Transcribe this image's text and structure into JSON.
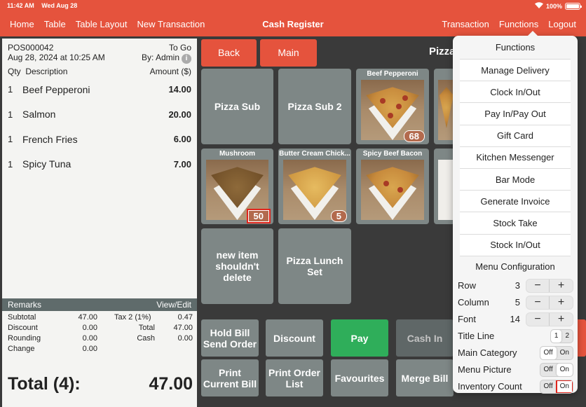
{
  "status_bar": {
    "time": "11:42 AM",
    "date": "Wed Aug 28",
    "wifi": "wifi-icon",
    "battery": "100%"
  },
  "nav": {
    "left": [
      "Home",
      "Table",
      "Table Layout",
      "New Transaction"
    ],
    "title": "Cash Register",
    "right": [
      "Transaction",
      "Functions",
      "Logout"
    ]
  },
  "receipt": {
    "number": "POS000042",
    "order_type": "To Go",
    "datetime": "Aug 28, 2024 at 10:25 AM",
    "by": "By: Admin",
    "columns": {
      "qty": "Qty",
      "description": "Description",
      "amount": "Amount ($)"
    },
    "items": [
      {
        "qty": "1",
        "description": "Beef Pepperoni",
        "amount": "14.00"
      },
      {
        "qty": "1",
        "description": "Salmon",
        "amount": "20.00"
      },
      {
        "qty": "1",
        "description": "French Fries",
        "amount": "6.00"
      },
      {
        "qty": "1",
        "description": "Spicy Tuna",
        "amount": "7.00"
      }
    ],
    "remarks_label": "Remarks",
    "view_edit": "View/Edit",
    "totals": {
      "subtotal_label": "Subtotal",
      "subtotal": "47.00",
      "tax_label": "Tax 2 (1%)",
      "tax": "0.47",
      "discount_label": "Discount",
      "discount": "0.00",
      "total_label": "Total",
      "total": "47.00",
      "rounding_label": "Rounding",
      "rounding": "0.00",
      "cash_label": "Cash",
      "cash": "0.00",
      "change_label": "Change",
      "change": "0.00"
    },
    "grand_total_label": "Total (4):",
    "grand_total": "47.00"
  },
  "main": {
    "back_label": "Back",
    "main_label": "Main",
    "category_title": "Pizza",
    "tiles": [
      {
        "name": "Pizza Sub"
      },
      {
        "name": "Pizza Sub 2"
      },
      {
        "name": "Beef Pepperoni",
        "count": "68"
      },
      {
        "name": "Mushroom",
        "count": "50"
      },
      {
        "name": "Butter Cream Chick...",
        "count": "5"
      },
      {
        "name": "Spicy Beef Bacon"
      },
      {
        "name": "new item shouldn't delete"
      },
      {
        "name": "Pizza Lunch Set"
      }
    ],
    "actions": {
      "hold_bill": "Hold Bill\nSend Order",
      "discount": "Discount",
      "pay": "Pay",
      "cash_in": "Cash In",
      "print_bill": "Print\nCurrent Bill",
      "print_order": "Print Order\nList",
      "favourites": "Favourites",
      "merge_bill": "Merge Bill"
    }
  },
  "functions_popover": {
    "title": "Functions",
    "items": [
      "Manage Delivery",
      "Clock In/Out",
      "Pay In/Pay Out",
      "Gift Card",
      "Kitchen Messenger",
      "Bar Mode",
      "Generate Invoice",
      "Stock Take",
      "Stock In/Out"
    ],
    "menu_config_label": "Menu Configuration",
    "steppers": [
      {
        "label": "Row",
        "value": "3"
      },
      {
        "label": "Column",
        "value": "5"
      },
      {
        "label": "Font",
        "value": "14"
      }
    ],
    "stepper_minus": "−",
    "stepper_plus": "+",
    "title_line": {
      "label": "Title Line",
      "options": [
        "1",
        "2"
      ],
      "selected": "1"
    },
    "main_category": {
      "label": "Main Category",
      "off": "Off",
      "on": "On",
      "selected": "Off"
    },
    "menu_picture": {
      "label": "Menu Picture",
      "off": "Off",
      "on": "On",
      "selected": "On"
    },
    "inventory_count": {
      "label": "Inventory Count",
      "off": "Off",
      "on": "On",
      "selected": "On"
    }
  },
  "colors": {
    "brand": "#e5533d",
    "tile": "#7e8786",
    "pay": "#2fae5a",
    "highlight": "#e0241b"
  }
}
